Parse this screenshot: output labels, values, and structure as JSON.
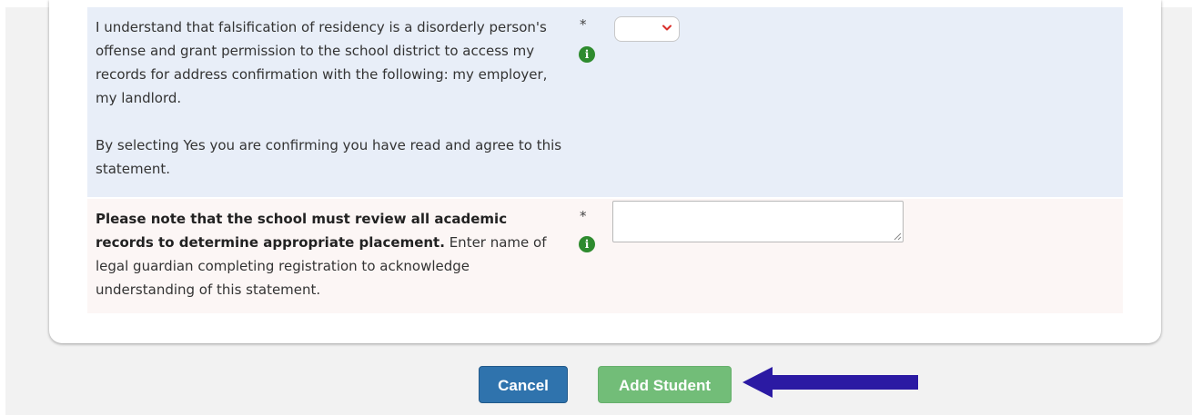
{
  "form": {
    "residency": {
      "label_line1": "I understand that falsification of residency is a disorderly person's offense and grant permission to the school district to access my records for address confirmation with the following: my employer, my landlord.",
      "label_line2": "By selecting Yes you are confirming you have read and agree to this statement.",
      "required_marker": "*",
      "info_icon": "info-icon",
      "select_value": ""
    },
    "academic": {
      "label_bold": "Please note that the school must review all academic records to determine appropriate placement.",
      "label_rest": " Enter name of legal guardian completing registration to acknowledge understanding of this statement.",
      "required_marker": "*",
      "info_icon": "info-icon",
      "input_value": ""
    }
  },
  "actions": {
    "cancel_label": "Cancel",
    "add_student_label": "Add Student"
  },
  "annotation": {
    "icon": "arrow-left",
    "color": "#2b1aa3"
  },
  "colors": {
    "cancel_bg": "#2f73ad",
    "add_bg": "#72bd78",
    "info_green": "#2e8b2e",
    "row_blue": "#e8eef8",
    "row_pink": "#fcf6f5"
  }
}
